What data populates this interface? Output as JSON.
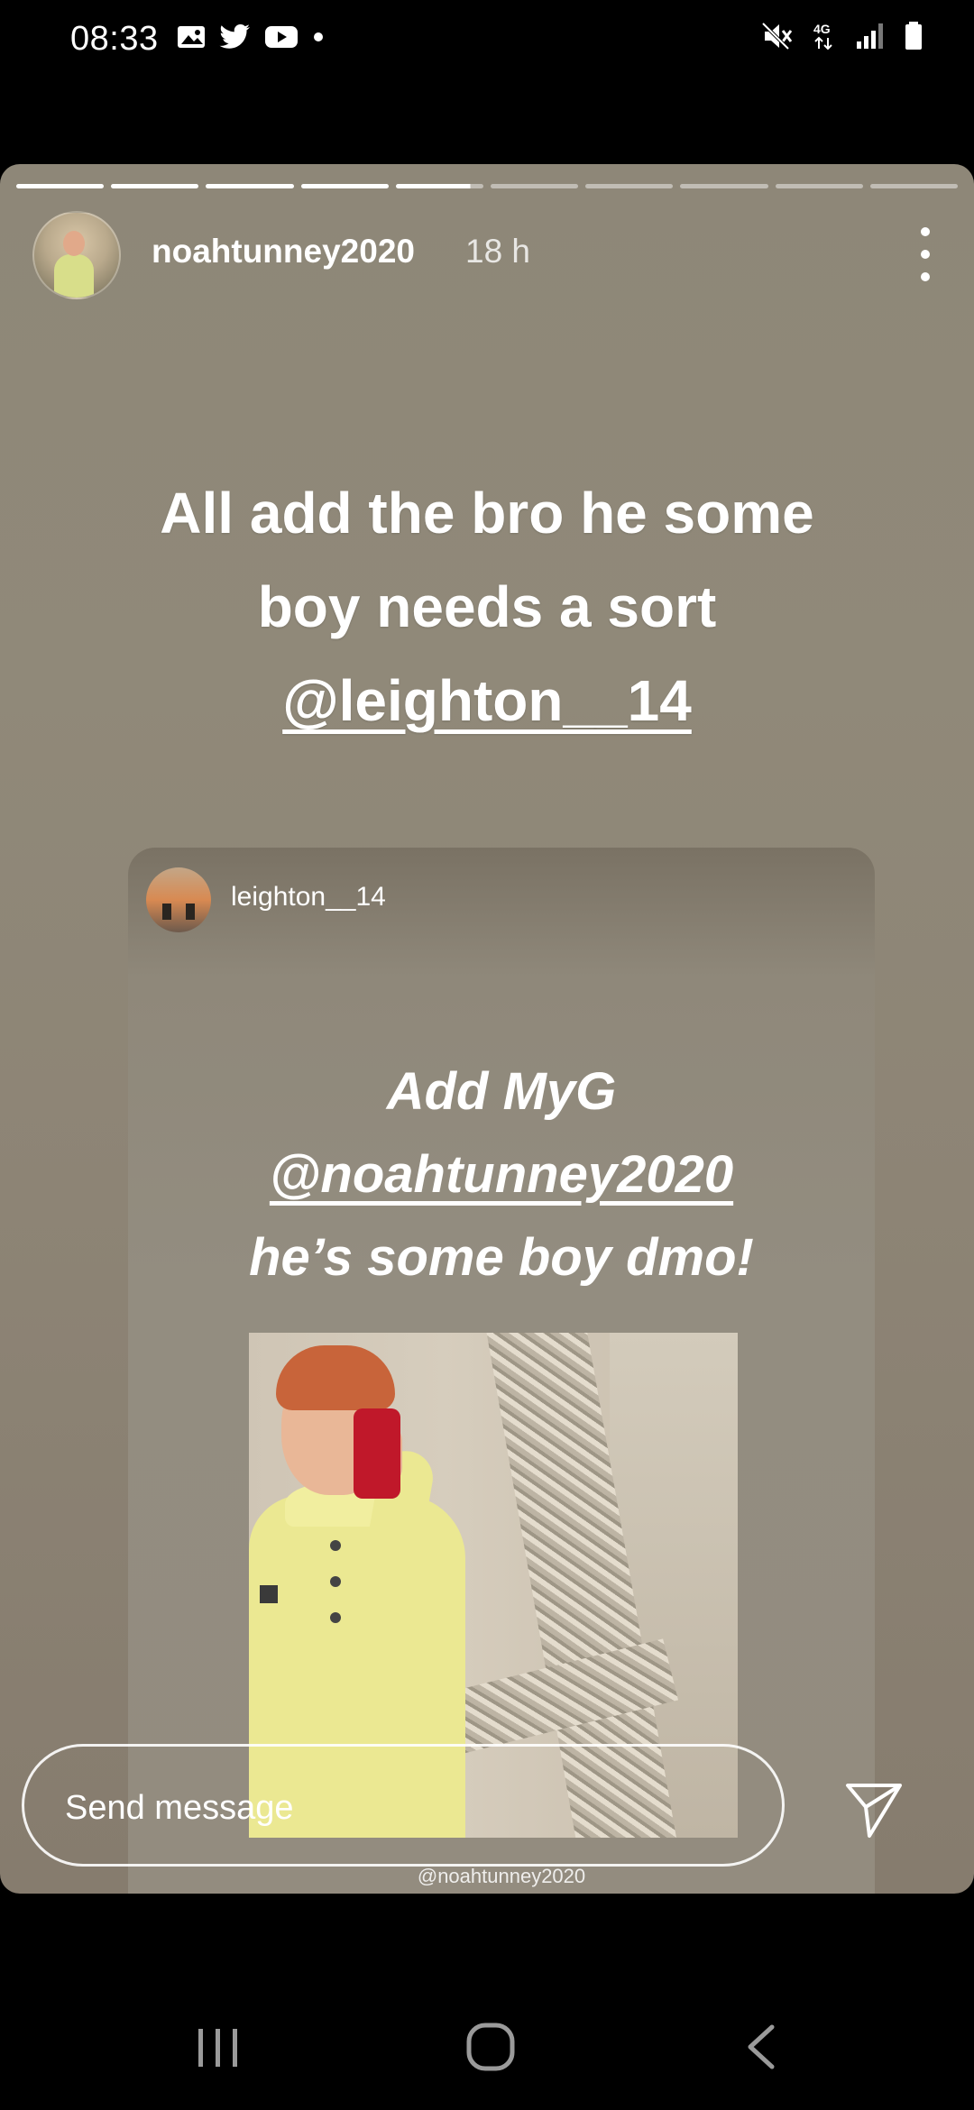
{
  "status_bar": {
    "time": "08:33",
    "left_icons": [
      "gallery-icon",
      "twitter-icon",
      "youtube-icon",
      "dot-icon"
    ],
    "right_icons": [
      "mute-icon",
      "4g-icon",
      "signal-icon",
      "battery-icon"
    ],
    "network_label": "4G"
  },
  "story": {
    "progress": {
      "total_segments": 10,
      "completed": 4,
      "active_index": 4
    },
    "header": {
      "username": "noahtunney2020",
      "time_ago": "18 h"
    },
    "headline": {
      "line1": "All add the bro he some",
      "line2": "boy needs a sort",
      "mention": "@leighton__14"
    },
    "embedded_story": {
      "username": "leighton__14",
      "line1": "Add MyG",
      "mention": "@noahtunney2020",
      "line3": "he’s some boy dmo!",
      "tag": "@noahtunney2020"
    },
    "message": {
      "placeholder": "Send message"
    }
  },
  "colors": {
    "background": "#000000",
    "story_bg": "#8e8778",
    "text": "#ffffff",
    "shirt": "#ebe892",
    "phone": "#c0182a"
  },
  "nav_bar": {
    "buttons": [
      "recents-icon",
      "home-icon",
      "back-icon"
    ]
  }
}
